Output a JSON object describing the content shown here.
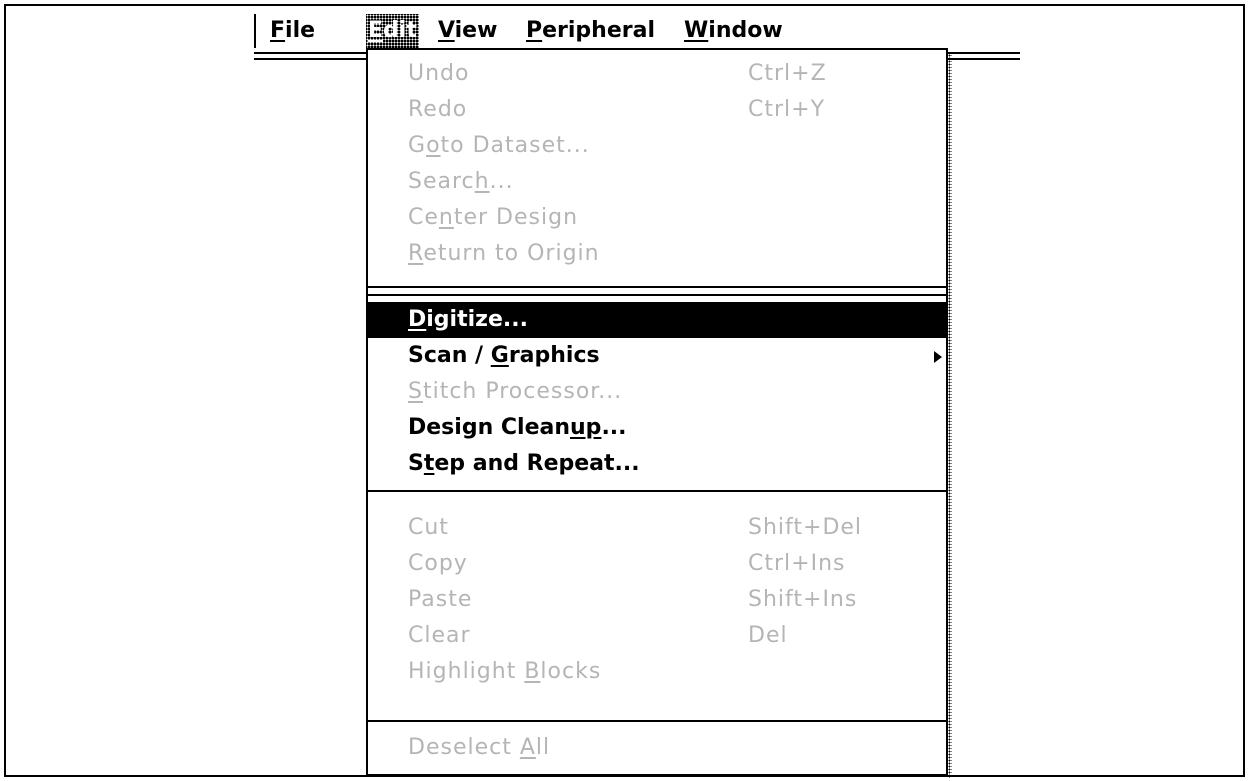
{
  "menubar": {
    "items": [
      {
        "mnemonic": "F",
        "rest": "ile"
      },
      {
        "mnemonic": "E",
        "rest": "dit"
      },
      {
        "mnemonic": "V",
        "rest": "iew"
      },
      {
        "mnemonic": "P",
        "rest": "eripheral"
      },
      {
        "mnemonic": "W",
        "rest": "indow"
      }
    ],
    "active_index": 1
  },
  "edit_menu": {
    "items": [
      {
        "pre": "Undo",
        "mn": "",
        "post": "",
        "shortcut": "Ctrl+Z",
        "enabled": false
      },
      {
        "pre": "Redo",
        "mn": "",
        "post": "",
        "shortcut": "Ctrl+Y",
        "enabled": false
      },
      {
        "pre": "G",
        "mn": "o",
        "post": "to Dataset...",
        "shortcut": "",
        "enabled": false
      },
      {
        "pre": "Searc",
        "mn": "h",
        "post": "...",
        "shortcut": "",
        "enabled": false
      },
      {
        "pre": "Ce",
        "mn": "n",
        "post": "ter Design",
        "shortcut": "",
        "enabled": false
      },
      {
        "pre": "",
        "mn": "R",
        "post": "eturn to Origin",
        "shortcut": "",
        "enabled": false
      },
      {
        "pre": "",
        "mn": "D",
        "post": "igitize...",
        "shortcut": "",
        "enabled": true,
        "highlighted": true
      },
      {
        "pre": "Scan / ",
        "mn": "G",
        "post": "raphics",
        "shortcut": "",
        "enabled": true,
        "submenu": true
      },
      {
        "pre": "",
        "mn": "S",
        "post": "titch Processor...",
        "shortcut": "",
        "enabled": false
      },
      {
        "pre": "Design Clean",
        "mn": "up",
        "post": "...",
        "shortcut": "",
        "enabled": true
      },
      {
        "pre": "S",
        "mn": "t",
        "post": "ep and Repeat...",
        "shortcut": "",
        "enabled": true
      },
      {
        "pre": "Cut",
        "mn": "",
        "post": "",
        "shortcut": "Shift+Del",
        "enabled": false
      },
      {
        "pre": "Copy",
        "mn": "",
        "post": "",
        "shortcut": "Ctrl+Ins",
        "enabled": false
      },
      {
        "pre": "Paste",
        "mn": "",
        "post": "",
        "shortcut": "Shift+Ins",
        "enabled": false
      },
      {
        "pre": "Clear",
        "mn": "",
        "post": "",
        "shortcut": "Del",
        "enabled": false
      },
      {
        "pre": "Highlight ",
        "mn": "B",
        "post": "locks",
        "shortcut": "",
        "enabled": false
      },
      {
        "pre": "Deselect ",
        "mn": "A",
        "post": "ll",
        "shortcut": "",
        "enabled": false
      }
    ]
  },
  "colors": {
    "disabled_text": "#b5b5b5",
    "highlight_bg": "#000000",
    "highlight_text": "#ffffff"
  }
}
